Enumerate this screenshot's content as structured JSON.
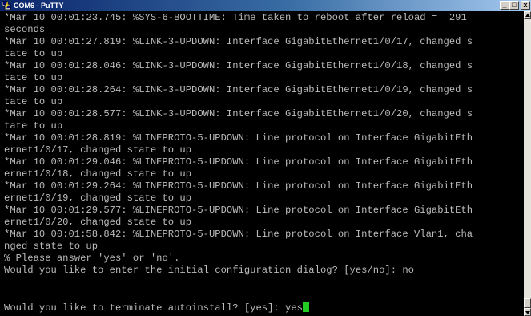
{
  "window": {
    "title": "COM6 - PuTTY"
  },
  "controls": {
    "minimize": "_",
    "maximize": "□",
    "close": "x"
  },
  "terminal": {
    "lines": [
      "*Mar 10 00:01:23.745: %SYS-6-BOOTTIME: Time taken to reboot after reload =  291",
      "seconds",
      "*Mar 10 00:01:27.819: %LINK-3-UPDOWN: Interface GigabitEthernet1/0/17, changed s",
      "tate to up",
      "*Mar 10 00:01:28.046: %LINK-3-UPDOWN: Interface GigabitEthernet1/0/18, changed s",
      "tate to up",
      "*Mar 10 00:01:28.264: %LINK-3-UPDOWN: Interface GigabitEthernet1/0/19, changed s",
      "tate to up",
      "*Mar 10 00:01:28.577: %LINK-3-UPDOWN: Interface GigabitEthernet1/0/20, changed s",
      "tate to up",
      "*Mar 10 00:01:28.819: %LINEPROTO-5-UPDOWN: Line protocol on Interface GigabitEth",
      "ernet1/0/17, changed state to up",
      "*Mar 10 00:01:29.046: %LINEPROTO-5-UPDOWN: Line protocol on Interface GigabitEth",
      "ernet1/0/18, changed state to up",
      "*Mar 10 00:01:29.264: %LINEPROTO-5-UPDOWN: Line protocol on Interface GigabitEth",
      "ernet1/0/19, changed state to up",
      "*Mar 10 00:01:29.577: %LINEPROTO-5-UPDOWN: Line protocol on Interface GigabitEth",
      "ernet1/0/20, changed state to up",
      "*Mar 10 00:01:58.842: %LINEPROTO-5-UPDOWN: Line protocol on Interface Vlan1, cha",
      "nged state to up",
      "% Please answer 'yes' or 'no'.",
      "Would you like to enter the initial configuration dialog? [yes/no]: no",
      "",
      "Would you like to terminate autoinstall? [yes]: yes"
    ]
  },
  "colors": {
    "background": "#000000",
    "text": "#bbbbbb",
    "cursor": "#22cc22"
  }
}
